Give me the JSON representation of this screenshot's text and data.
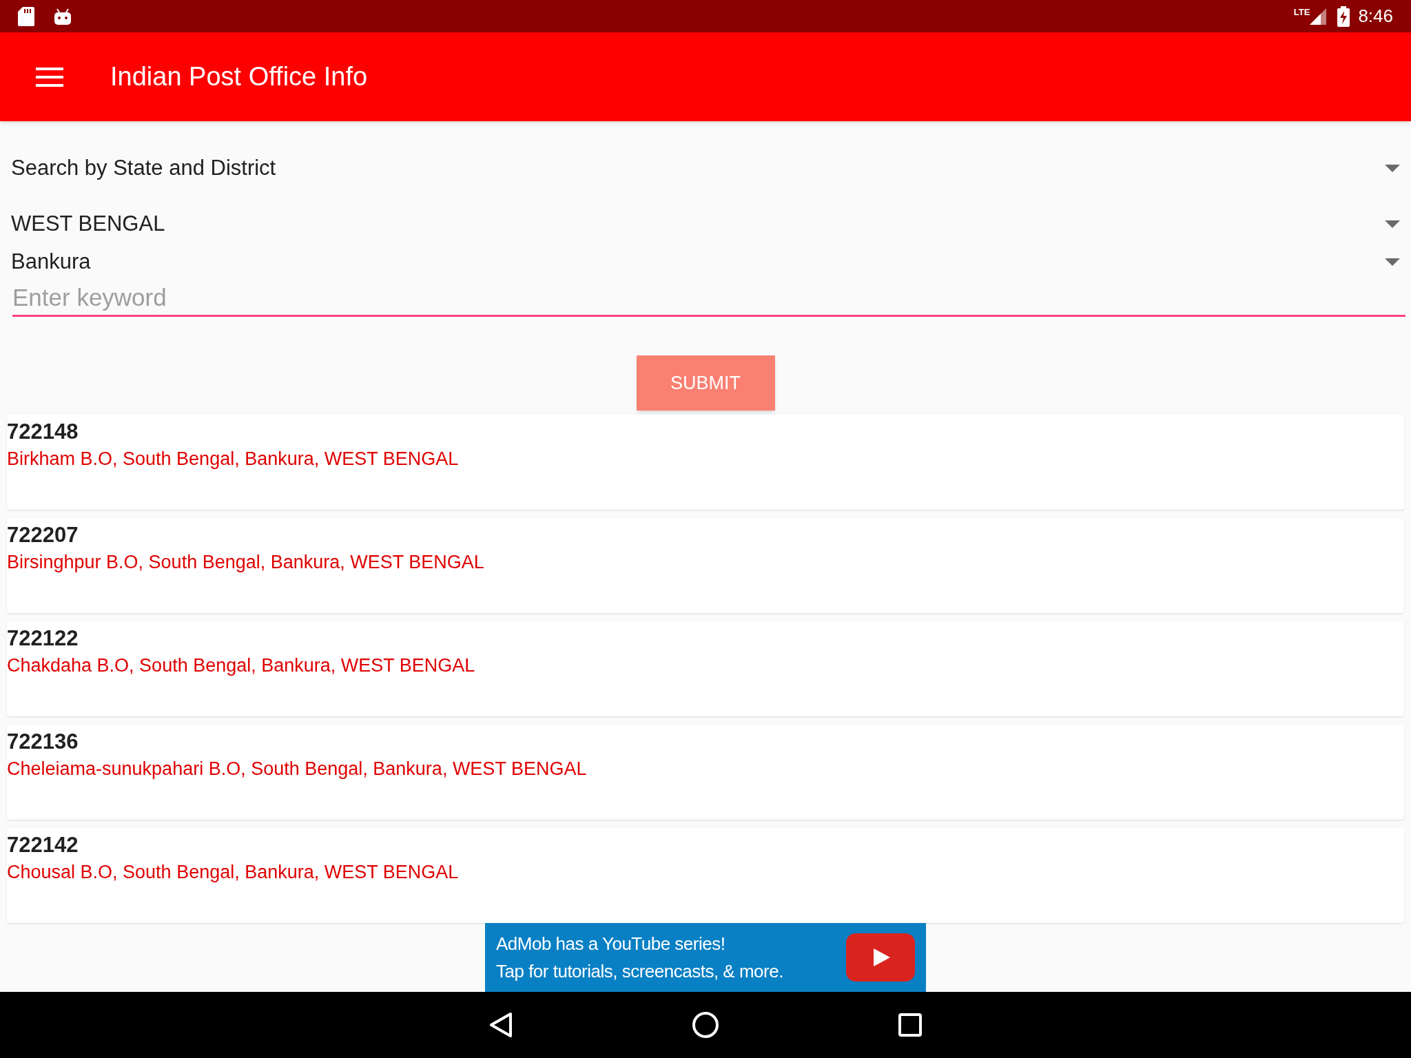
{
  "status_bar": {
    "time": "8:46",
    "network": "LTE"
  },
  "app_bar": {
    "title": "Indian Post Office Info"
  },
  "search_mode": {
    "value": "Search by State and District"
  },
  "state": {
    "value": "WEST BENGAL"
  },
  "district": {
    "value": "Bankura"
  },
  "keyword": {
    "placeholder": "Enter keyword"
  },
  "submit_button": "SUBMIT",
  "results": [
    {
      "pincode": "722148",
      "address": "Birkham B.O, South Bengal, Bankura, WEST BENGAL"
    },
    {
      "pincode": "722207",
      "address": "Birsinghpur B.O, South Bengal, Bankura, WEST BENGAL"
    },
    {
      "pincode": "722122",
      "address": "Chakdaha B.O, South Bengal, Bankura, WEST BENGAL"
    },
    {
      "pincode": "722136",
      "address": "Cheleiama-sunukpahari B.O, South Bengal, Bankura, WEST BENGAL"
    },
    {
      "pincode": "722142",
      "address": "Chousal B.O, South Bengal, Bankura, WEST BENGAL"
    }
  ],
  "ad_banner": {
    "line_1": "AdMob has a YouTube series!",
    "line_2": "Tap for tutorials, screencasts, & more."
  }
}
